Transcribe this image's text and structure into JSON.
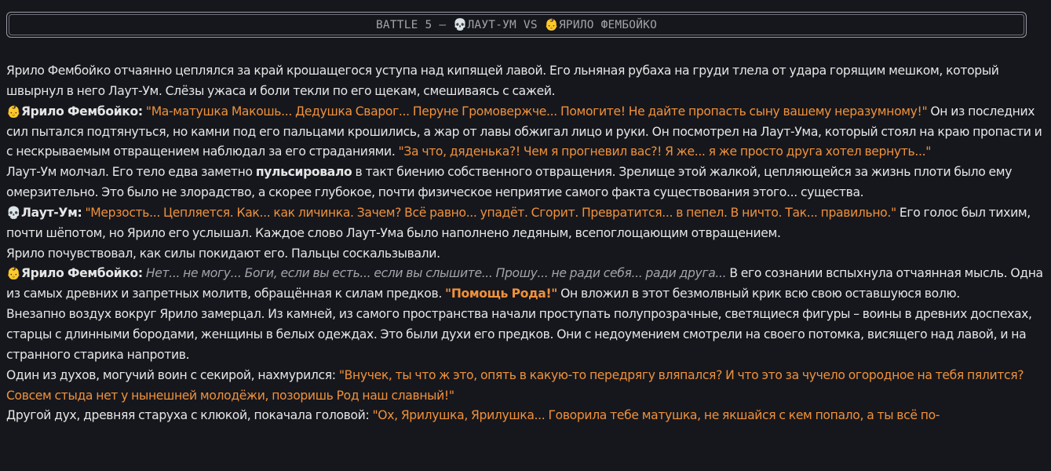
{
  "header": {
    "battle": "BATTLE 5 – ",
    "fighter1_icon": "💀",
    "fighter1": "ЛАУТ-УМ",
    "vs": " VS ",
    "fighter2_icon": "👶",
    "fighter2": "ЯРИЛО ФЕМБОЙКО"
  },
  "icons": {
    "yarilo": "👶",
    "laut": "💀"
  },
  "p1": {
    "text": "Ярило Фембойко отчаянно цеплялся за край крошащегося уступа над кипящей лавой. Его льняная рубаха на груди тлела от удара горящим мешком, который швырнул в него Лаут-Ум. Слёзы ужаса и боли текли по его щекам, смешиваясь с сажей."
  },
  "p2": {
    "speaker": "Ярило Фембойко:",
    "quote1": "\"Ма-матушка Макошь... Дедушка Сварог... Перуне Громовержче... Помогите! Не дайте пропасть сыну вашему неразумному!\"",
    "text": " Он из последних сил пытался подтянуться, но камни под его пальцами крошились, а жар от лавы обжигал лицо и руки. Он посмотрел на Лаут-Ума, который стоял на краю пропасти и с нескрываемым отвращением наблюдал за его страданиями. ",
    "quote2": "\"За что, дяденька?! Чем я прогневил вас?! Я же... я же просто друга хотел вернуть...\""
  },
  "p3": {
    "text1": "Лаут-Ум молчал. Его тело едва заметно ",
    "bold": "пульсировало",
    "text2": " в такт биению собственного отвращения. Зрелище этой жалкой, цепляющейся за жизнь плоти было ему омерзительно. Это было не злорадство, а скорее глубокое, почти физическое неприятие самого факта существования этого... существа."
  },
  "p4": {
    "speaker": "Лаут-Ум:",
    "quote": "\"Мерзость... Цепляется. Как... как личинка. Зачем? Всё равно... упадёт. Сгорит. Превратится... в пепел. В ничто. Так... правильно.\"",
    "text": " Его голос был тихим, почти шёпотом, но Ярило его услышал. Каждое слово Лаут-Ума было наполнено ледяным, всепоглощающим отвращением."
  },
  "p5": {
    "text": "Ярило почувствовал, как силы покидают его. Пальцы соскальзывали."
  },
  "p6": {
    "speaker": "Ярило Фембойко:",
    "whisper": "Нет... не могу... Боги, если вы есть... если вы слышите... Прошу... не ради себя... ради друга...",
    "text1": " В его сознании вспыхнула отчаянная мысль. Одна из самых древних и запретных молитв, обращённая к силам предков. ",
    "prayer": "\"Помощь Рода!\"",
    "text2": " Он вложил в этот безмолвный крик всю свою оставшуюся волю."
  },
  "p7": {
    "text": "Внезапно воздух вокруг Ярило замерцал. Из камней, из самого пространства начали проступать полупрозрачные, светящиеся фигуры – воины в древних доспехах, старцы с длинными бородами, женщины в белых одеждах. Это были духи его предков. Они с недоумением смотрели на своего потомка, висящего над лавой, и на странного старика напротив."
  },
  "p8": {
    "text": "Один из духов, могучий воин с секирой, нахмурился: ",
    "quote": "\"Внучек, ты что ж это, опять в какую-то передрягу вляпался? И что это за чучело огородное на тебя пялится? Совсем стыда нет у нынешней молодёжи, позоришь Род наш славный!\""
  },
  "p9": {
    "text": "Другой дух, древняя старуха с клюкой, покачала головой: ",
    "quote": "\"Ох, Ярилушка, Ярилушка... Говорила тебе матушка, не якшайся с кем попало, а ты всё по-"
  }
}
